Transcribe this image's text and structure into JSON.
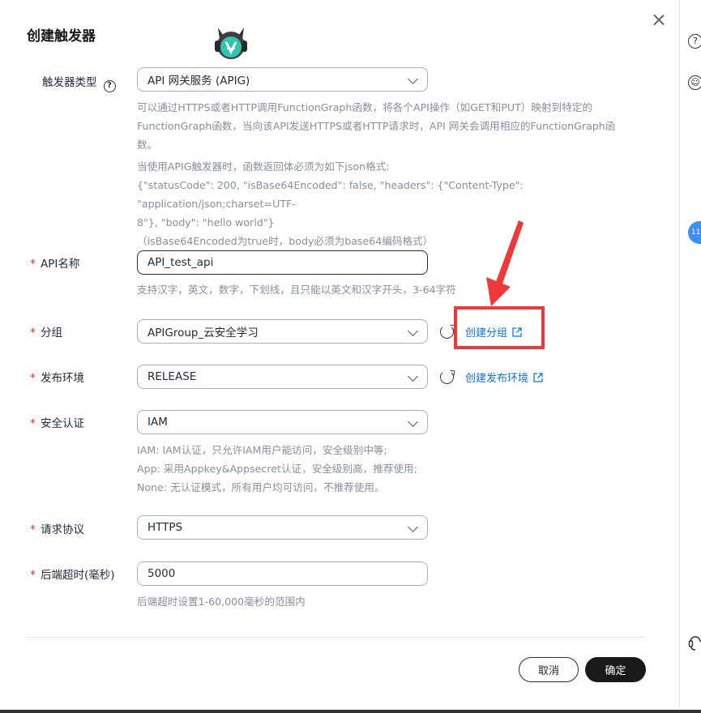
{
  "dialog": {
    "title": "创建触发器",
    "close_label": "×"
  },
  "form": {
    "trigger_type": {
      "label": "触发器类型",
      "help_icon": "?",
      "value": "API 网关服务 (APIG)",
      "desc_lines": [
        "可以通过HTTPS或者HTTP调用FunctionGraph函数，将各个API操作（如GET和PUT）映射到特定的",
        "FunctionGraph函数，当向该API发送HTTPS或者HTTP请求时，API 网关会调用相应的FunctionGraph函",
        "数。"
      ],
      "json_lines": [
        "当使用APIG触发器时，函数返回体必须为如下json格式:",
        "{\"statusCode\": 200, \"isBase64Encoded\": false, \"headers\": {\"Content-Type\": \"application/json;charset=UTF-",
        "8\"}, \"body\": \"hello world\"}",
        "（isBase64Encoded为true时，body必须为base64编码格式）"
      ]
    },
    "api_name": {
      "label": "API名称",
      "value": "API_test_api",
      "help": "支持汉字，英文，数字，下划线，且只能以英文和汉字开头，3-64字符"
    },
    "group": {
      "label": "分组",
      "value": "APIGroup_云安全学习",
      "link": "创建分组"
    },
    "env": {
      "label": "发布环境",
      "value": "RELEASE",
      "link": "创建发布环境"
    },
    "auth": {
      "label": "安全认证",
      "value": "IAM",
      "help_lines": [
        "IAM:  IAM认证，只允许IAM用户能访问，安全级别中等;",
        "App:  采用Appkey&Appsecret认证，安全级别高，推荐使用;",
        "None:  无认证模式，所有用户均可访问，不推荐使用。"
      ]
    },
    "protocol": {
      "label": "请求协议",
      "value": "HTTPS"
    },
    "timeout": {
      "label": "后端超时(毫秒)",
      "value": "5000",
      "help": "后端超时设置1-60,000毫秒的范围内"
    },
    "required_mark": "*"
  },
  "footer": {
    "cancel": "取消",
    "confirm": "确定"
  },
  "rail": {
    "help_icon": "?",
    "face_icon": "☺",
    "badge": "11"
  },
  "colors": {
    "link": "#0d74e3",
    "required": "#e03232",
    "highlight": "#f03838",
    "primary_button": "#191919"
  }
}
